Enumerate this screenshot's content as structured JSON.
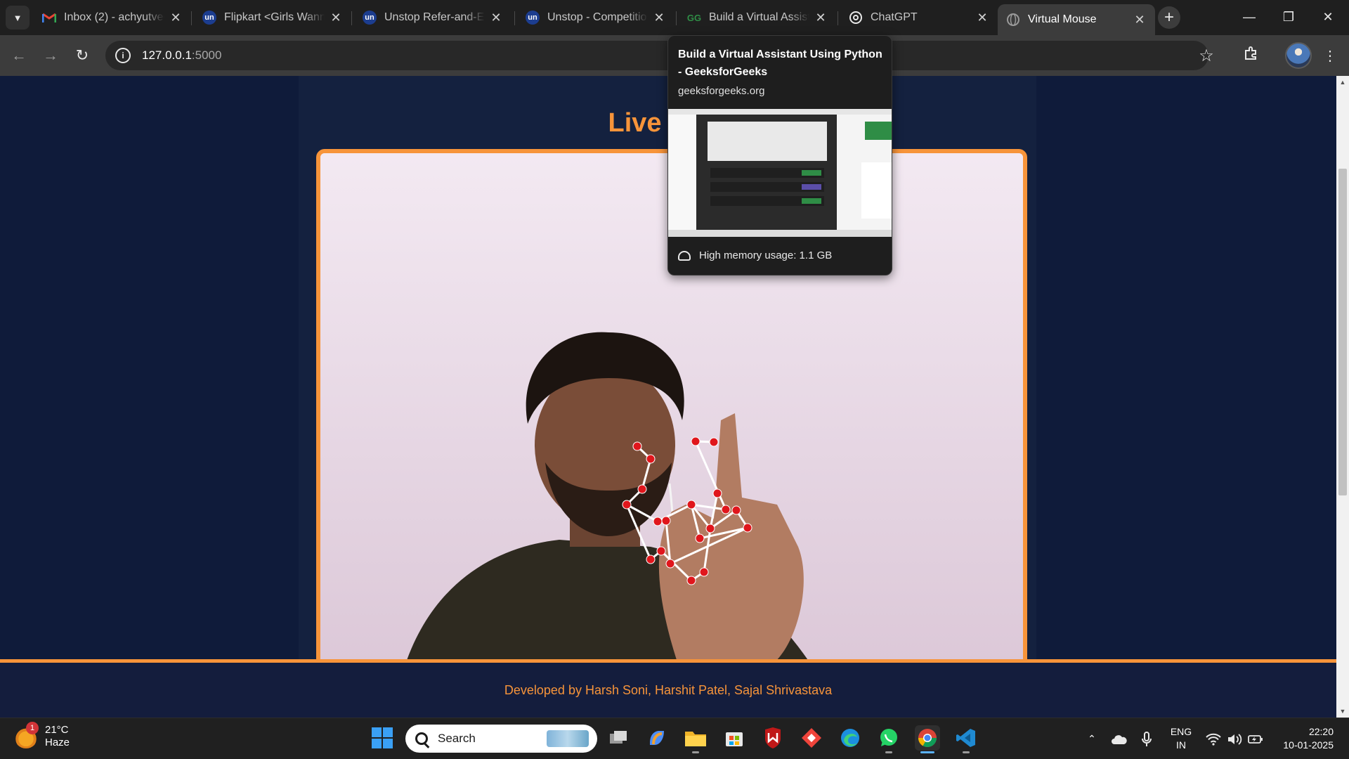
{
  "tabs": [
    {
      "title": "Inbox (2) - achyutvee",
      "favicon": "gmail-icon"
    },
    {
      "title": "Flipkart <Girls Wanna",
      "favicon": "unstop-icon"
    },
    {
      "title": "Unstop Refer-and-Ea",
      "favicon": "unstop-icon"
    },
    {
      "title": "Unstop - Competitio",
      "favicon": "unstop-icon"
    },
    {
      "title": "Build a Virtual Assista",
      "favicon": "geeksforgeeks-icon"
    },
    {
      "title": "ChatGPT",
      "favicon": "chatgpt-icon"
    },
    {
      "title": "Virtual Mouse",
      "favicon": "globe-icon",
      "active": true
    }
  ],
  "favicon_text": {
    "unstop": "un",
    "gfg": "GG"
  },
  "toolbar": {
    "url_host": "127.0.0.1",
    "url_port": ":5000"
  },
  "page": {
    "heading": "Live Cam",
    "footer": "Developed by Harsh Soni, Harshit Patel, Sajal Shrivastava"
  },
  "hover_card": {
    "title": "Build a Virtual Assistant Using Python - GeeksforGeeks",
    "domain": "geeksforgeeks.org",
    "memory": "High memory usage: 1.1 GB"
  },
  "taskbar": {
    "weather_temp": "21°C",
    "weather_cond": "Haze",
    "weather_badge": "1",
    "search_label": "Search",
    "lang_line1": "ENG",
    "lang_line2": "IN",
    "time": "22:20",
    "date": "10-01-2025"
  },
  "colors": {
    "accent_orange": "#f7943a",
    "page_bg": "#0f1b3a",
    "landmark_red": "#e0161c"
  }
}
